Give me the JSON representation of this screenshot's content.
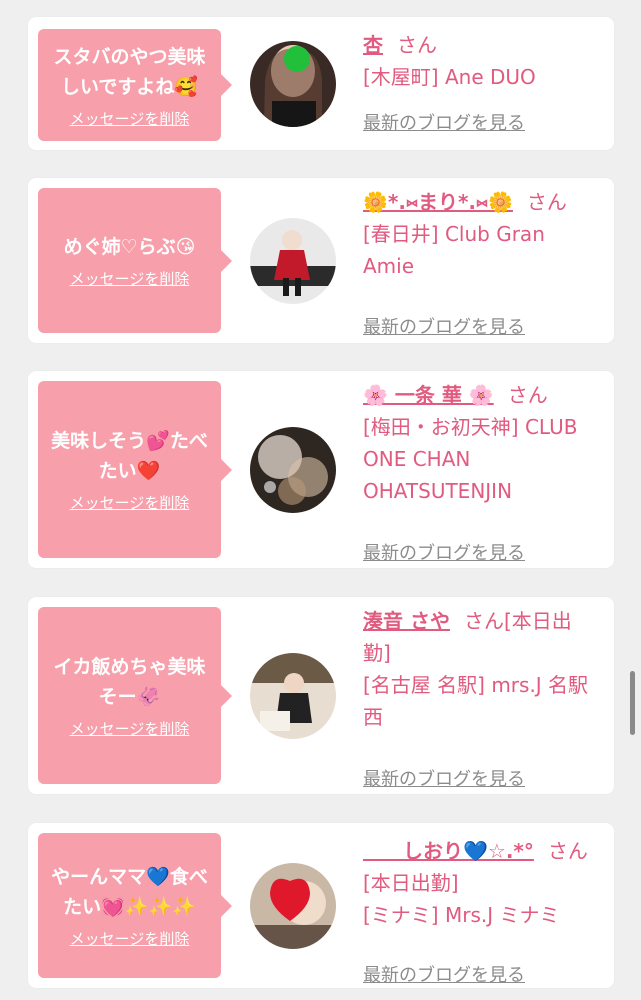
{
  "entries": [
    {
      "message": "スタバのやつ美味しいですよね🥰",
      "delete_label": "メッセージを削除",
      "name": "杏",
      "san": "さん",
      "shop": "[木屋町] Ane DUO",
      "blog_label": "最新のブログを見る"
    },
    {
      "message": "めぐ姉♡らぶ😘",
      "delete_label": "メッセージを削除",
      "name": "🌼*.⑅まり*.⑅🌼",
      "san": "さん",
      "shop": "[春日井] Club Gran Amie",
      "blog_label": "最新のブログを見る"
    },
    {
      "message": "美味しそう💕たべたい❤️",
      "delete_label": "メッセージを削除",
      "name": "🌸 一条 華 🌸",
      "san": "さん",
      "shop": "[梅田・お初天神] CLUB ONE CHAN OHATSUTENJIN",
      "blog_label": "最新のブログを見る"
    },
    {
      "message": "イカ飯めちゃ美味そー🦑",
      "delete_label": "メッセージを削除",
      "name": "湊音 さや",
      "san": "さん[本日出勤]",
      "shop": "[名古屋 名駅] mrs.J 名駅西",
      "blog_label": "最新のブログを見る"
    },
    {
      "message": "やーんママ💙食べたい💓✨✨✨",
      "delete_label": "メッセージを削除",
      "name": "　　しおり💙☆.*°",
      "san": "さん[本日出勤]",
      "shop": "[ミナミ] Mrs.J ミナミ",
      "blog_label": "最新のブログを見る"
    }
  ],
  "colors": {
    "bubble": "#f7a0ac",
    "accent": "#e15a7f",
    "link_gray": "#8c8c8c",
    "background": "#efefef"
  }
}
